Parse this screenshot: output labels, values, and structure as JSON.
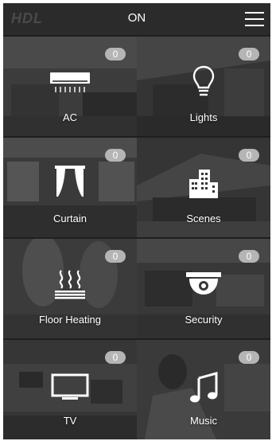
{
  "header": {
    "logo": "HDL",
    "title": "ON"
  },
  "tiles": [
    {
      "label": "AC",
      "count": "0",
      "icon": "air-conditioner-icon"
    },
    {
      "label": "Lights",
      "count": "0",
      "icon": "lightbulb-icon"
    },
    {
      "label": "Curtain",
      "count": "0",
      "icon": "curtain-icon"
    },
    {
      "label": "Scenes",
      "count": "0",
      "icon": "buildings-icon"
    },
    {
      "label": "Floor Heating",
      "count": "0",
      "icon": "floor-heating-icon"
    },
    {
      "label": "Security",
      "count": "0",
      "icon": "security-camera-icon"
    },
    {
      "label": "TV",
      "count": "0",
      "icon": "tv-icon"
    },
    {
      "label": "Music",
      "count": "0",
      "icon": "music-note-icon"
    }
  ],
  "colors": {
    "background": "#1f1f1f",
    "topbar": "#2b2b2b",
    "badge": "#b5b5b5",
    "text": "#ffffff"
  }
}
